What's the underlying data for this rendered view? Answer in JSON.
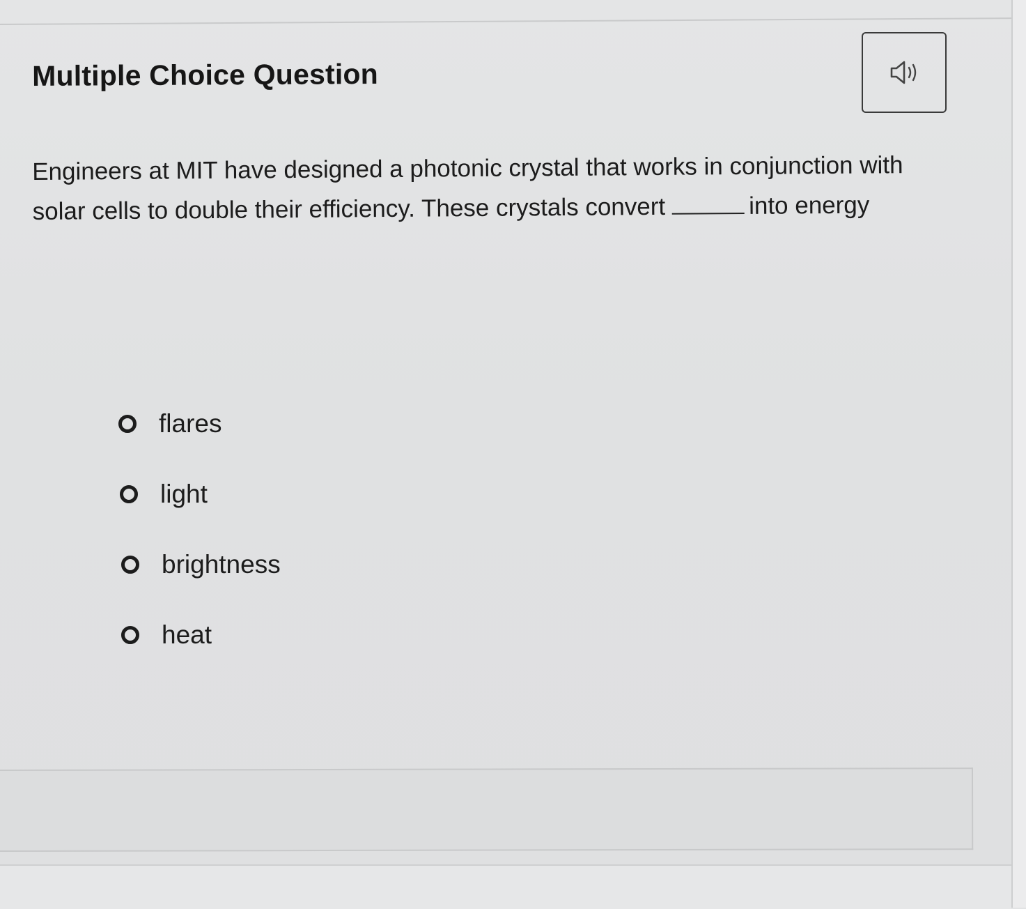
{
  "question": {
    "heading": "Multiple Choice Question",
    "audio_icon": "speaker-icon",
    "text_before_blank": "Engineers at MIT have designed a photonic crystal that works in conjunction with solar cells to double their efficiency. These crystals convert",
    "text_after_blank": "into energy"
  },
  "options": [
    {
      "label": "flares"
    },
    {
      "label": "light"
    },
    {
      "label": "brightness"
    },
    {
      "label": "heat"
    }
  ],
  "colors": {
    "background": "#e2e3e4",
    "text": "#1a1a1a",
    "border": "#3a3a3a"
  }
}
